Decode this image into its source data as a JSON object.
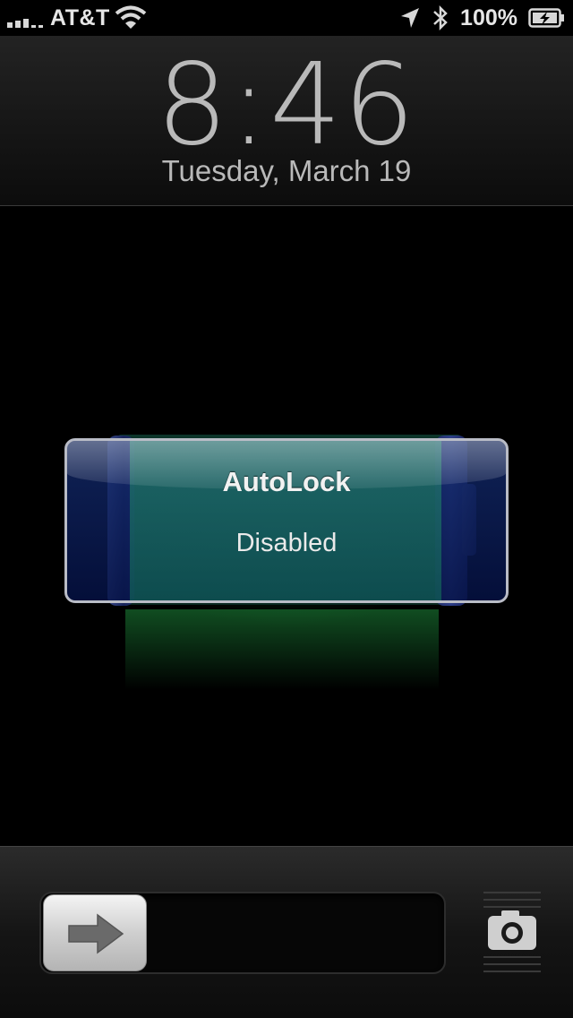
{
  "status_bar": {
    "carrier": "AT&T",
    "battery_percent": "100%",
    "icons": [
      "signal-bars-icon",
      "wifi-icon",
      "location-arrow-icon",
      "bluetooth-icon",
      "battery-charging-icon"
    ]
  },
  "lock_screen": {
    "time": "8:46",
    "date": "Tuesday, March 19"
  },
  "hud": {
    "title": "AutoLock",
    "message": "Disabled"
  },
  "slider": {
    "knob_icon": "arrow-right-icon",
    "camera_icon": "camera-icon"
  },
  "colors": {
    "hud_border": "#b9bcc6",
    "battery_green": "#1f8a6a",
    "hud_blue": "#0a1a5a",
    "clock_text": "#b9b9b9"
  }
}
